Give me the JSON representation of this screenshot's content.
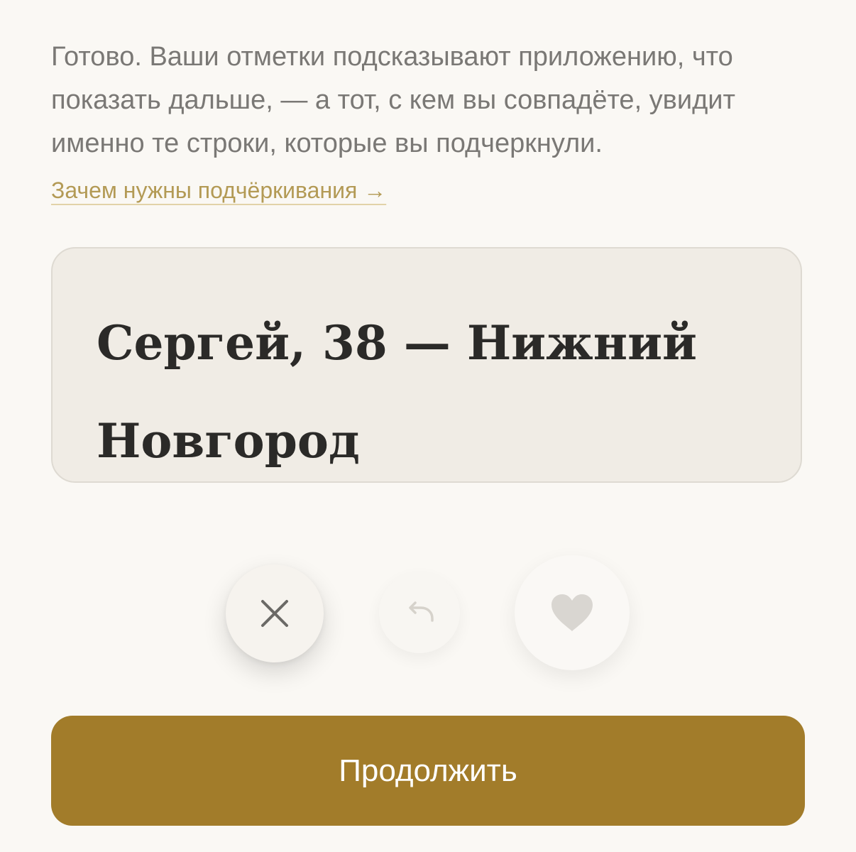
{
  "intro": {
    "text": "Готово. Ваши отметки подсказывают приложению, что показать дальше, — а тот, с кем вы совпадёте, увидит именно те строки, которые вы подчеркнули."
  },
  "link": {
    "label": "Зачем нужны подчёркивания →"
  },
  "card": {
    "title": "Сергей, 38 — Нижний Новгород"
  },
  "actions": {
    "pass_icon": "close-icon",
    "undo_icon": "undo-icon",
    "like_icon": "heart-icon"
  },
  "footer": {
    "continue_label": "Продолжить"
  },
  "colors": {
    "accent": "#a27c2a",
    "link": "#b39a55",
    "background": "#faf8f4",
    "card_background": "#f0ece5"
  }
}
